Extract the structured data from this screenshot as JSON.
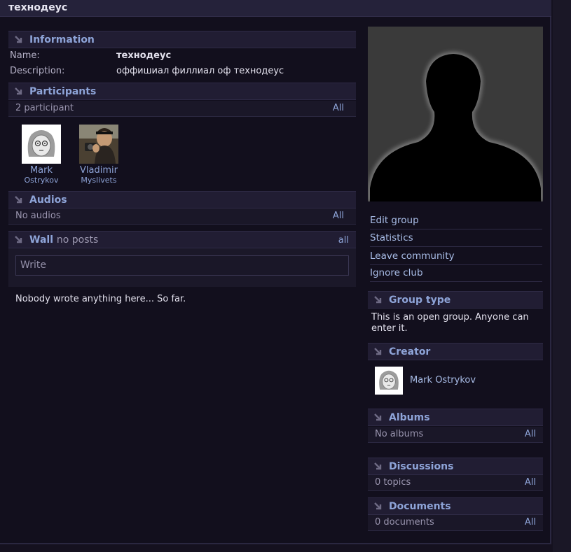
{
  "page_title": "технодеус",
  "info": {
    "header": "Information",
    "name_label": "Name:",
    "name_value": "технодеус",
    "desc_label": "Description:",
    "desc_value": "оффишиал филлиал оф технодеус"
  },
  "participants": {
    "header": "Participants",
    "count": "2 participant",
    "all": "All",
    "members": [
      {
        "first": "Mark",
        "last": "Ostrykov",
        "avatar": "sketch-face-avatar"
      },
      {
        "first": "Vladimir",
        "last": "Myslivets",
        "avatar": "photo-avatar"
      }
    ]
  },
  "audios": {
    "header": "Audios",
    "status": "No audios",
    "all": "All"
  },
  "wall": {
    "header": "Wall",
    "sub": "no posts",
    "all": "all",
    "placeholder": "Write",
    "empty": "Nobody wrote anything here... So far."
  },
  "menu": [
    "Edit group",
    "Statistics",
    "Leave community",
    "Ignore club"
  ],
  "group_type": {
    "header": "Group type",
    "text": "This is an open group. Anyone can enter it."
  },
  "creator": {
    "header": "Creator",
    "name": "Mark Ostrykov"
  },
  "albums": {
    "header": "Albums",
    "status": "No albums",
    "all": "All"
  },
  "discussions": {
    "header": "Discussions",
    "status": "0 topics",
    "all": "All"
  },
  "documents": {
    "header": "Documents",
    "status": "0 documents",
    "all": "All"
  },
  "colors": {
    "accent": "#8ea4d8",
    "background": "#120f1d",
    "header_bg": "#211d33"
  }
}
